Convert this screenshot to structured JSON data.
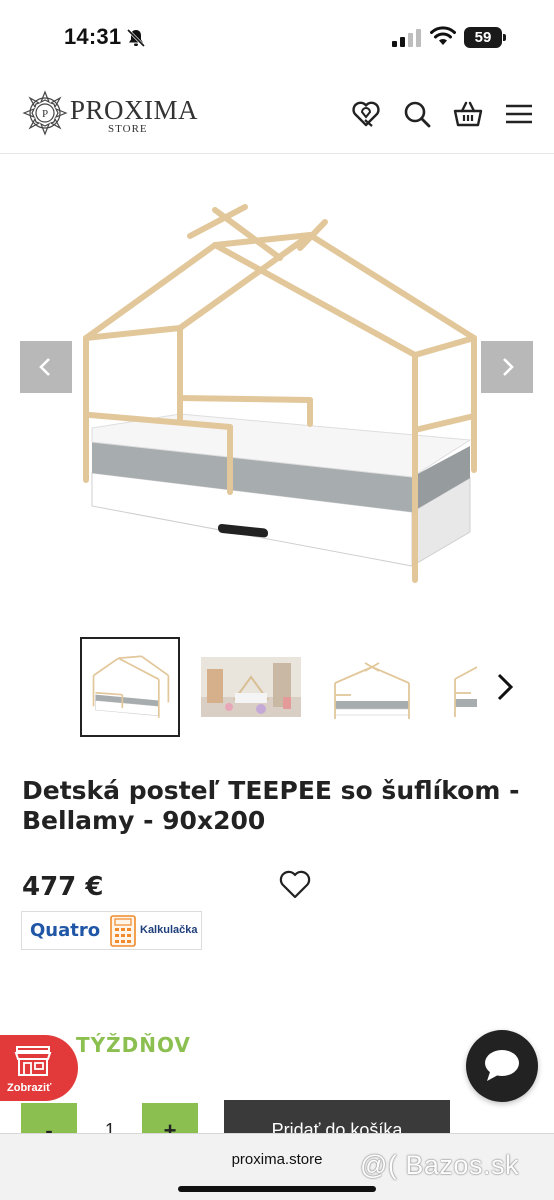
{
  "status_bar": {
    "time": "14:31",
    "battery": "59"
  },
  "header": {
    "logo_name": "PROXIMA",
    "logo_sub": "STORE",
    "logo_letter": "P",
    "icons": [
      "wishlist-heart-icon",
      "search-icon",
      "basket-icon",
      "menu-icon"
    ]
  },
  "gallery": {
    "prev_icon": "chevron-left-icon",
    "next_icon": "chevron-right-icon",
    "thumbnail_count": 4,
    "active_thumbnail": 1
  },
  "product": {
    "title": "Detská posteľ TEEPEE so šuflíkom - Bellamy - 90x200",
    "price": "477 €",
    "quatro_brand": "Quatro",
    "quatro_label": "Kalkulačka",
    "weeks_text": "TÝŽDŇOV"
  },
  "badge": {
    "label": "Zobraziť"
  },
  "cart": {
    "minus": "-",
    "quantity": "1",
    "plus": "+",
    "add_label": "Pridať do košíka"
  },
  "browser": {
    "url": "proxima.store"
  },
  "watermark": "@( Bazos.sk",
  "colors": {
    "accent_green": "#8bbf50",
    "badge_red": "#e23a3a",
    "dark_button": "#3a3a3a",
    "quatro_blue": "#1f56a5",
    "wood": "#e2c79a"
  }
}
